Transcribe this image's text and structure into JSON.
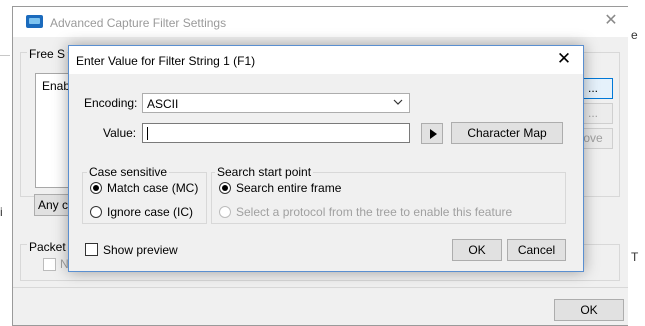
{
  "outer": {
    "title": "Advanced Capture Filter Settings",
    "group_label": "Free S",
    "list_text": "Enab",
    "buttons": [
      "...",
      "...",
      "ove"
    ],
    "any_label": "Any c",
    "packet_label": "Packet",
    "packet_checkbox_label": "N",
    "ok_label": "OK"
  },
  "background": {
    "right_text_top": "e",
    "right_text_bottom": "T",
    "left_text": "i"
  },
  "dialog": {
    "title": "Enter Value for Filter String 1 (F1)",
    "encoding_label": "Encoding:",
    "encoding_value": "ASCII",
    "value_label": "Value:",
    "value_text": "",
    "char_map_label": "Character Map",
    "case_group": {
      "label": "Case sensitive",
      "options": [
        {
          "label": "Match case (MC)",
          "checked": true
        },
        {
          "label": "Ignore case (IC)",
          "checked": false
        }
      ]
    },
    "search_group": {
      "label": "Search start point",
      "options": [
        {
          "label": "Search entire frame",
          "checked": true,
          "disabled": false
        },
        {
          "label": "Select a protocol from the tree to enable this feature",
          "checked": false,
          "disabled": true
        }
      ]
    },
    "show_preview_label": "Show preview",
    "show_preview_checked": false,
    "ok_label": "OK",
    "cancel_label": "Cancel"
  },
  "colors": {
    "accent": "#0078d7",
    "dialog_border": "#5a8fd0",
    "window_bg": "#f0f0f0"
  },
  "icons": [
    "app-window-icon",
    "close-icon",
    "chevron-down-icon",
    "play-icon"
  ]
}
